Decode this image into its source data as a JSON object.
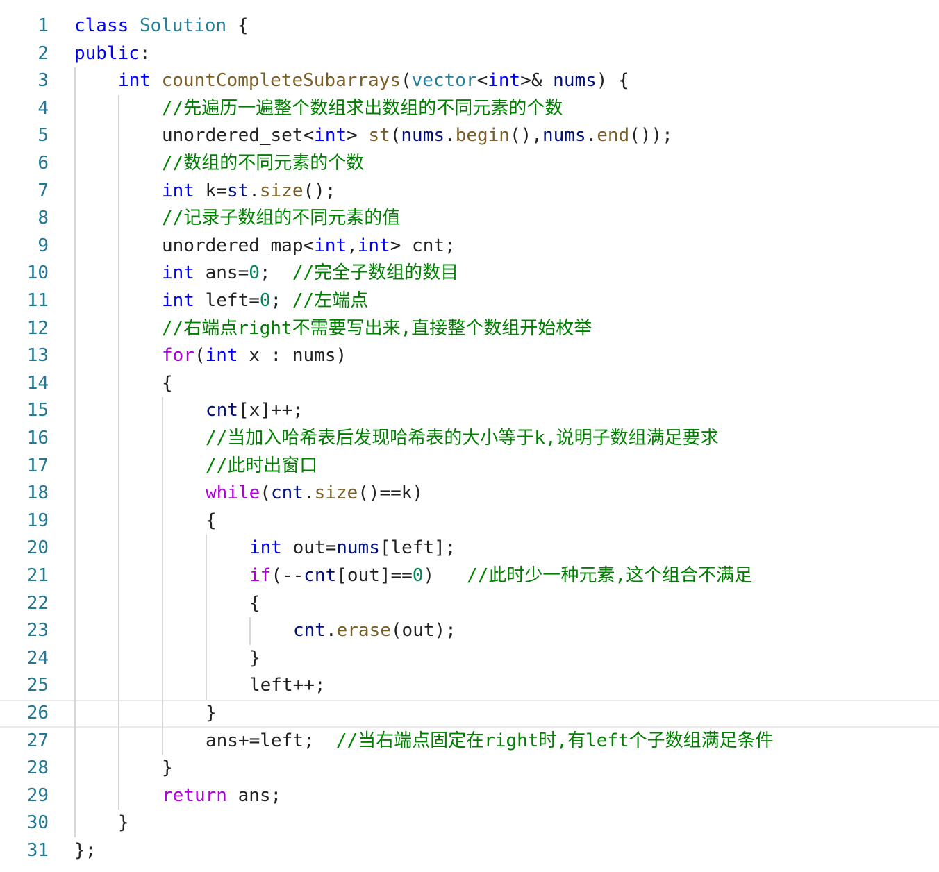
{
  "editor": {
    "language": "C++",
    "current_line": 26,
    "colors": {
      "line_number": "#237893",
      "keyword": "#0000ff",
      "control": "#af00db",
      "function": "#795e26",
      "type": "#267f99",
      "variable": "#001080",
      "number": "#098658",
      "comment": "#008000",
      "text": "#222222",
      "indent_guide": "#d6d6d6"
    },
    "lines": [
      {
        "n": "1",
        "indent": 0,
        "tokens": [
          [
            "kw",
            "class"
          ],
          [
            "op",
            " "
          ],
          [
            "ty",
            "Solution"
          ],
          [
            "op",
            " {"
          ]
        ]
      },
      {
        "n": "2",
        "indent": 0,
        "tokens": [
          [
            "kw",
            "public"
          ],
          [
            "op",
            ":"
          ]
        ]
      },
      {
        "n": "3",
        "indent": 1,
        "tokens": [
          [
            "kw",
            "int"
          ],
          [
            "op",
            " "
          ],
          [
            "fn",
            "countCompleteSubarrays"
          ],
          [
            "op",
            "("
          ],
          [
            "ty",
            "vector"
          ],
          [
            "op",
            "<"
          ],
          [
            "kw",
            "int"
          ],
          [
            "op",
            ">& "
          ],
          [
            "var",
            "nums"
          ],
          [
            "op",
            ") {"
          ]
        ]
      },
      {
        "n": "4",
        "indent": 2,
        "tokens": [
          [
            "cm",
            "//先遍历一遍整个数组求出数组的不同元素的个数"
          ]
        ]
      },
      {
        "n": "5",
        "indent": 2,
        "tokens": [
          [
            "op",
            "unordered_set<"
          ],
          [
            "kw",
            "int"
          ],
          [
            "op",
            "> "
          ],
          [
            "fn",
            "st"
          ],
          [
            "op",
            "("
          ],
          [
            "var",
            "nums"
          ],
          [
            "op",
            "."
          ],
          [
            "fn",
            "begin"
          ],
          [
            "op",
            "(),"
          ],
          [
            "var",
            "nums"
          ],
          [
            "op",
            "."
          ],
          [
            "fn",
            "end"
          ],
          [
            "op",
            "());"
          ]
        ]
      },
      {
        "n": "6",
        "indent": 2,
        "tokens": [
          [
            "cm",
            "//数组的不同元素的个数"
          ]
        ]
      },
      {
        "n": "7",
        "indent": 2,
        "tokens": [
          [
            "kw",
            "int"
          ],
          [
            "op",
            " k="
          ],
          [
            "var",
            "st"
          ],
          [
            "op",
            "."
          ],
          [
            "fn",
            "size"
          ],
          [
            "op",
            "();"
          ]
        ]
      },
      {
        "n": "8",
        "indent": 2,
        "tokens": [
          [
            "cm",
            "//记录子数组的不同元素的值"
          ]
        ]
      },
      {
        "n": "9",
        "indent": 2,
        "tokens": [
          [
            "op",
            "unordered_map<"
          ],
          [
            "kw",
            "int"
          ],
          [
            "op",
            ","
          ],
          [
            "kw",
            "int"
          ],
          [
            "op",
            "> cnt;"
          ]
        ]
      },
      {
        "n": "10",
        "indent": 2,
        "tokens": [
          [
            "kw",
            "int"
          ],
          [
            "op",
            " ans="
          ],
          [
            "num-lit",
            "0"
          ],
          [
            "op",
            ";  "
          ],
          [
            "cm",
            "//完全子数组的数目"
          ]
        ]
      },
      {
        "n": "11",
        "indent": 2,
        "tokens": [
          [
            "kw",
            "int"
          ],
          [
            "op",
            " left="
          ],
          [
            "num-lit",
            "0"
          ],
          [
            "op",
            "; "
          ],
          [
            "cm",
            "//左端点"
          ]
        ]
      },
      {
        "n": "12",
        "indent": 2,
        "tokens": [
          [
            "cm",
            "//右端点right不需要写出来,直接整个数组开始枚举"
          ]
        ]
      },
      {
        "n": "13",
        "indent": 2,
        "tokens": [
          [
            "ctl",
            "for"
          ],
          [
            "op",
            "("
          ],
          [
            "kw",
            "int"
          ],
          [
            "op",
            " x : nums)"
          ]
        ]
      },
      {
        "n": "14",
        "indent": 2,
        "tokens": [
          [
            "op",
            "{"
          ]
        ]
      },
      {
        "n": "15",
        "indent": 3,
        "tokens": [
          [
            "var",
            "cnt"
          ],
          [
            "op",
            "[x]++;"
          ]
        ]
      },
      {
        "n": "16",
        "indent": 3,
        "tokens": [
          [
            "cm",
            "//当加入哈希表后发现哈希表的大小等于k,说明子数组满足要求"
          ]
        ]
      },
      {
        "n": "17",
        "indent": 3,
        "tokens": [
          [
            "cm",
            "//此时出窗口"
          ]
        ]
      },
      {
        "n": "18",
        "indent": 3,
        "tokens": [
          [
            "ctl",
            "while"
          ],
          [
            "op",
            "("
          ],
          [
            "var",
            "cnt"
          ],
          [
            "op",
            "."
          ],
          [
            "fn",
            "size"
          ],
          [
            "op",
            "()==k)"
          ]
        ]
      },
      {
        "n": "19",
        "indent": 3,
        "tokens": [
          [
            "op",
            "{"
          ]
        ]
      },
      {
        "n": "20",
        "indent": 4,
        "tokens": [
          [
            "kw",
            "int"
          ],
          [
            "op",
            " out="
          ],
          [
            "var",
            "nums"
          ],
          [
            "op",
            "[left];"
          ]
        ]
      },
      {
        "n": "21",
        "indent": 4,
        "tokens": [
          [
            "ctl",
            "if"
          ],
          [
            "op",
            "(--"
          ],
          [
            "var",
            "cnt"
          ],
          [
            "op",
            "[out]=="
          ],
          [
            "num-lit",
            "0"
          ],
          [
            "op",
            ")   "
          ],
          [
            "cm",
            "//此时少一种元素,这个组合不满足"
          ]
        ]
      },
      {
        "n": "22",
        "indent": 4,
        "tokens": [
          [
            "op",
            "{"
          ]
        ]
      },
      {
        "n": "23",
        "indent": 5,
        "tokens": [
          [
            "var",
            "cnt"
          ],
          [
            "op",
            "."
          ],
          [
            "fn",
            "erase"
          ],
          [
            "op",
            "(out);"
          ]
        ]
      },
      {
        "n": "24",
        "indent": 4,
        "tokens": [
          [
            "op",
            "}"
          ]
        ]
      },
      {
        "n": "25",
        "indent": 4,
        "tokens": [
          [
            "op",
            "left++;"
          ]
        ]
      },
      {
        "n": "26",
        "indent": 3,
        "tokens": [
          [
            "op",
            "}"
          ]
        ]
      },
      {
        "n": "27",
        "indent": 3,
        "tokens": [
          [
            "op",
            "ans+=left;  "
          ],
          [
            "cm",
            "//当右端点固定在right时,有left个子数组满足条件"
          ]
        ]
      },
      {
        "n": "28",
        "indent": 2,
        "tokens": [
          [
            "op",
            "}"
          ]
        ]
      },
      {
        "n": "29",
        "indent": 2,
        "tokens": [
          [
            "ctl",
            "return"
          ],
          [
            "op",
            " ans;"
          ]
        ]
      },
      {
        "n": "30",
        "indent": 1,
        "tokens": [
          [
            "op",
            "}"
          ]
        ]
      },
      {
        "n": "31",
        "indent": 0,
        "tokens": [
          [
            "op",
            "};"
          ]
        ]
      }
    ]
  }
}
